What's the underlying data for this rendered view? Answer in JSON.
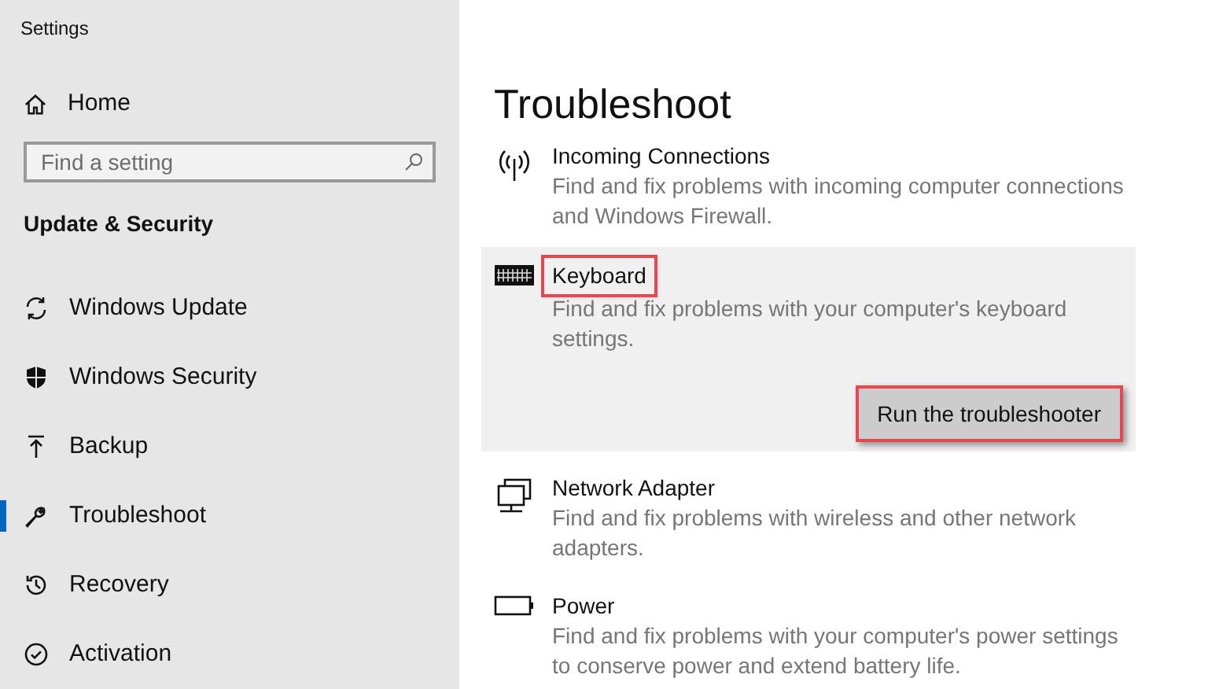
{
  "window": {
    "title": "Settings"
  },
  "sidebar": {
    "home": "Home",
    "search": {
      "placeholder": "Find a setting"
    },
    "section": "Update & Security",
    "items": [
      {
        "label": "Windows Update",
        "selected": false
      },
      {
        "label": "Windows Security",
        "selected": false
      },
      {
        "label": "Backup",
        "selected": false
      },
      {
        "label": "Troubleshoot",
        "selected": true
      },
      {
        "label": "Recovery",
        "selected": false
      },
      {
        "label": "Activation",
        "selected": false
      }
    ]
  },
  "page": {
    "title": "Troubleshoot",
    "troubleshooters": [
      {
        "title": "Incoming Connections",
        "description": "Find and fix problems with incoming computer connections and Windows Firewall.",
        "expanded": false,
        "highlighted": false
      },
      {
        "title": "Keyboard",
        "description": "Find and fix problems with your computer's keyboard settings.",
        "expanded": true,
        "highlighted": true,
        "button": {
          "label": "Run the troubleshooter",
          "highlighted": true
        }
      },
      {
        "title": "Network Adapter",
        "description": "Find and fix problems with wireless and other network adapters.",
        "expanded": false,
        "highlighted": false
      },
      {
        "title": "Power",
        "description": "Find and fix problems with your computer's power settings to conserve power and extend battery life.",
        "expanded": false,
        "highlighted": false
      }
    ]
  }
}
